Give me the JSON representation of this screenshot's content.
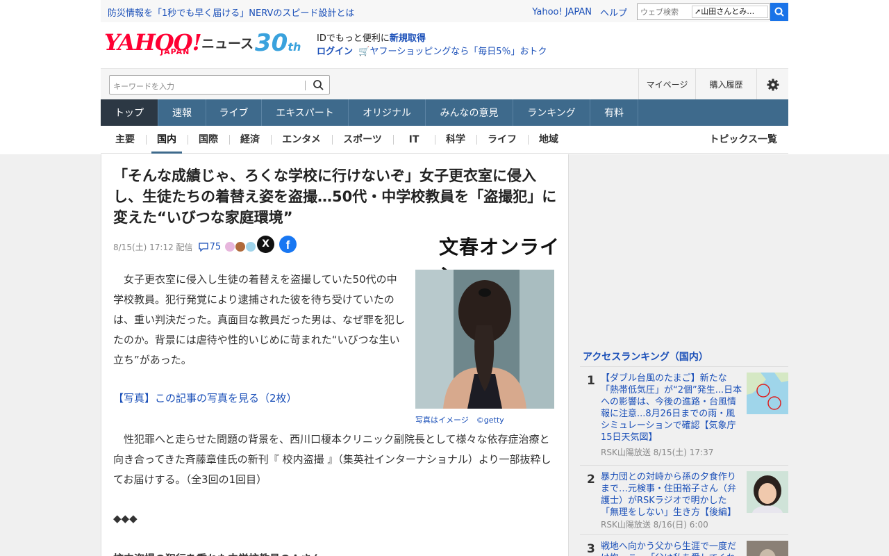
{
  "promo": {
    "link": "防災情報を「1秒でも早く届ける」NERVのスピード設計とは",
    "yahoo_japan": "Yahoo! JAPAN",
    "help": "ヘルプ",
    "web_search_placeholder": "ウェブ検索",
    "search_suggest": "山田さんとみ…"
  },
  "header": {
    "logo": "YAHOO!",
    "logo_sub": "JAPAN",
    "news": "ニュース",
    "anniversary": "30",
    "anniversary_suffix": "th",
    "id_text": "IDでもっと便利に",
    "register": "新規取得",
    "login": "ログイン",
    "shopping": "ヤフーショッピングなら「毎日5％」おトク"
  },
  "search": {
    "placeholder": "キーワードを入力",
    "mypage": "マイページ",
    "history": "購入履歴"
  },
  "nav": {
    "tabs": [
      "トップ",
      "速報",
      "ライブ",
      "エキスパート",
      "オリジナル",
      "みんなの意見",
      "ランキング",
      "有料"
    ]
  },
  "subnav": {
    "items": [
      "主要",
      "国内",
      "国際",
      "経済",
      "エンタメ",
      "スポーツ",
      "IT",
      "科学",
      "ライフ",
      "地域"
    ],
    "topics": "トピックス一覧"
  },
  "article": {
    "title": "「そんな成績じゃ、ろくな学校に行けないぞ」女子更衣室に侵入し、生徒たちの着替え姿を盗撮…50代・中学校教員を「盗撮犯」に変えた“いびつな家庭環境”",
    "date": "8/15(土) 17:12",
    "distributed": "配信",
    "comments": "75",
    "x_label": "X",
    "fb_label": "f",
    "publisher": "文春オンライン",
    "caption": "写真はイメージ　©getty",
    "p1": "　女子更衣室に侵入し生徒の着替えを盗撮していた50代の中学校教員。犯行発覚により逮捕された彼を待ち受けていたのは、重い判決だった。真面目な教員だった男は、なぜ罪を犯したのか。背景には虐待や性的いじめに苛まれた“いびつな生い立ち”があった。",
    "photo_link": "【写真】この記事の写真を見る（2枚）",
    "p3": "　性犯罪へと走らせた問題の背景を、西川口榎本クリニック副院長として様々な依存症治療と向き合ってきた斉藤章佳氏の新刊『 校内盗撮 』（集英社インターナショナル）より一部抜粋してお届けする。（全3回の1回目）",
    "divider": "◆◆◆",
    "p5": "校内盗撮の犯行を重ねた中学校教員のＡさん"
  },
  "ranking": {
    "title": "アクセスランキング（国内）",
    "items": [
      {
        "rank": "1",
        "headline": "【ダブル台風のたまご】新たな「熱帯低気圧」が“2個”発生...日本への影響は、今後の進路・台風情報に注意...8月26日までの雨・風シミュレーションで確認【気象庁15日天気図】",
        "source": "RSK山陽放送 8/15(土) 17:37"
      },
      {
        "rank": "2",
        "headline": "暴力団との対峙から孫の夕食作りまで…元検事・住田裕子さん（弁護士）がRSKラジオで明かした「無理をしない」生き方【後編】",
        "source": "RSK山陽放送 8/16(日) 6:00"
      },
      {
        "rank": "3",
        "headline": "戦地へ向かう父から生涯で一度だけ抱っこ…「父は私を愛してくれた"
      }
    ]
  },
  "colors": {
    "nav_bg": "#3e6a8c",
    "nav_active": "#2c3844",
    "link": "#1a4fb8",
    "brand_red": "#ff0033"
  }
}
